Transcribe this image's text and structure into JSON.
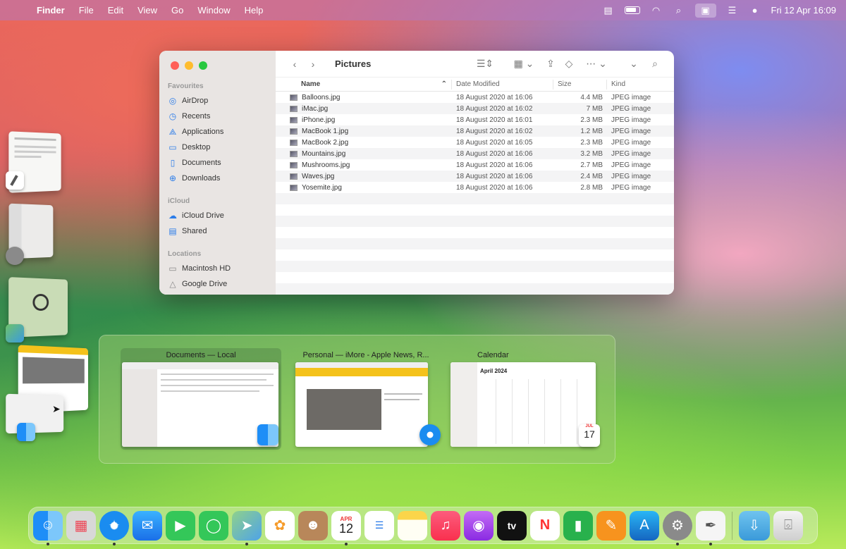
{
  "menubar": {
    "app_name": "Finder",
    "menus": [
      "File",
      "Edit",
      "View",
      "Go",
      "Window",
      "Help"
    ],
    "clock": "Fri 12 Apr  16:09"
  },
  "finder": {
    "title": "Pictures",
    "sidebar": {
      "favourites_label": "Favourites",
      "favourites": [
        "AirDrop",
        "Recents",
        "Applications",
        "Desktop",
        "Documents",
        "Downloads"
      ],
      "icloud_label": "iCloud",
      "icloud": [
        "iCloud Drive",
        "Shared"
      ],
      "locations_label": "Locations",
      "locations": [
        "Macintosh HD",
        "Google Drive"
      ]
    },
    "columns": {
      "name": "Name",
      "date": "Date Modified",
      "size": "Size",
      "kind": "Kind"
    },
    "files": [
      {
        "name": "Balloons.jpg",
        "date": "18 August 2020 at 16:06",
        "size": "4.4 MB",
        "kind": "JPEG image"
      },
      {
        "name": "iMac.jpg",
        "date": "18 August 2020 at 16:02",
        "size": "7 MB",
        "kind": "JPEG image"
      },
      {
        "name": "iPhone.jpg",
        "date": "18 August 2020 at 16:01",
        "size": "2.3 MB",
        "kind": "JPEG image"
      },
      {
        "name": "MacBook 1.jpg",
        "date": "18 August 2020 at 16:02",
        "size": "1.2 MB",
        "kind": "JPEG image"
      },
      {
        "name": "MacBook 2.jpg",
        "date": "18 August 2020 at 16:05",
        "size": "2.3 MB",
        "kind": "JPEG image"
      },
      {
        "name": "Mountains.jpg",
        "date": "18 August 2020 at 16:06",
        "size": "3.2 MB",
        "kind": "JPEG image"
      },
      {
        "name": "Mushrooms.jpg",
        "date": "18 August 2020 at 16:06",
        "size": "2.7 MB",
        "kind": "JPEG image"
      },
      {
        "name": "Waves.jpg",
        "date": "18 August 2020 at 16:06",
        "size": "2.4 MB",
        "kind": "JPEG image"
      },
      {
        "name": "Yosemite.jpg",
        "date": "18 August 2020 at 16:06",
        "size": "2.8 MB",
        "kind": "JPEG image"
      }
    ]
  },
  "switcher": {
    "items": [
      {
        "label": "Documents — Local"
      },
      {
        "label": "Personal — iMore - Apple News, R..."
      },
      {
        "label": "Calendar"
      }
    ],
    "calendar_month": "April 2024",
    "calendar_icon_month": "JUL",
    "calendar_icon_day": "17"
  },
  "dock": {
    "calendar_month": "APR",
    "calendar_day": "12",
    "tv_label": "tv",
    "icons": [
      "finder-icon",
      "launchpad-icon",
      "safari-icon",
      "mail-icon",
      "facetime-icon",
      "messages-icon",
      "maps-icon",
      "photos-icon",
      "contacts-icon",
      "calendar-icon",
      "reminders-icon",
      "notes-icon",
      "music-icon",
      "podcasts-icon",
      "tv-icon",
      "news-icon",
      "numbers-icon",
      "pages-icon",
      "app-store-icon",
      "system-settings-icon",
      "textedit-icon",
      "downloads-folder-icon",
      "trash-icon"
    ]
  }
}
